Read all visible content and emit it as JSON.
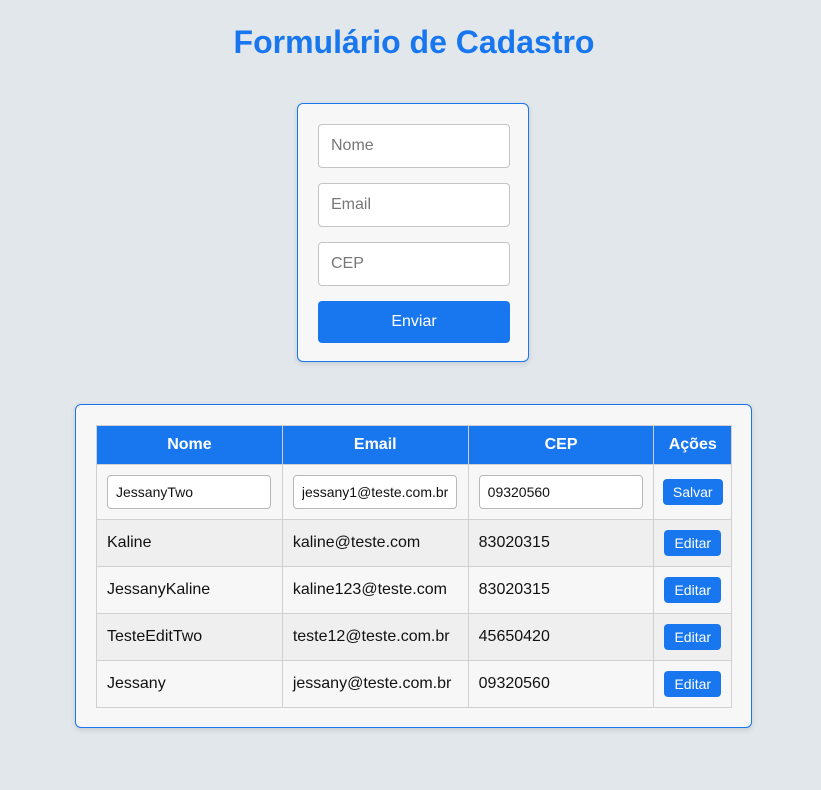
{
  "page_title": "Formulário de Cadastro",
  "form": {
    "nome_placeholder": "Nome",
    "email_placeholder": "Email",
    "cep_placeholder": "CEP",
    "submit_label": "Enviar"
  },
  "table": {
    "headers": {
      "nome": "Nome",
      "email": "Email",
      "cep": "CEP",
      "acoes": "Ações"
    },
    "editing_row": {
      "nome": "JessanyTwo",
      "email": "jessany1@teste.com.br",
      "cep": "09320560",
      "save_label": "Salvar"
    },
    "rows": [
      {
        "nome": "Kaline",
        "email": "kaline@teste.com",
        "cep": "83020315",
        "action_label": "Editar"
      },
      {
        "nome": "JessanyKaline",
        "email": "kaline123@teste.com",
        "cep": "83020315",
        "action_label": "Editar"
      },
      {
        "nome": "TesteEditTwo",
        "email": "teste12@teste.com.br",
        "cep": "45650420",
        "action_label": "Editar"
      },
      {
        "nome": "Jessany",
        "email": "jessany@teste.com.br",
        "cep": "09320560",
        "action_label": "Editar"
      }
    ]
  },
  "colors": {
    "accent": "#1877ee",
    "background": "#e2e7ec",
    "card": "#f7f7f7"
  }
}
